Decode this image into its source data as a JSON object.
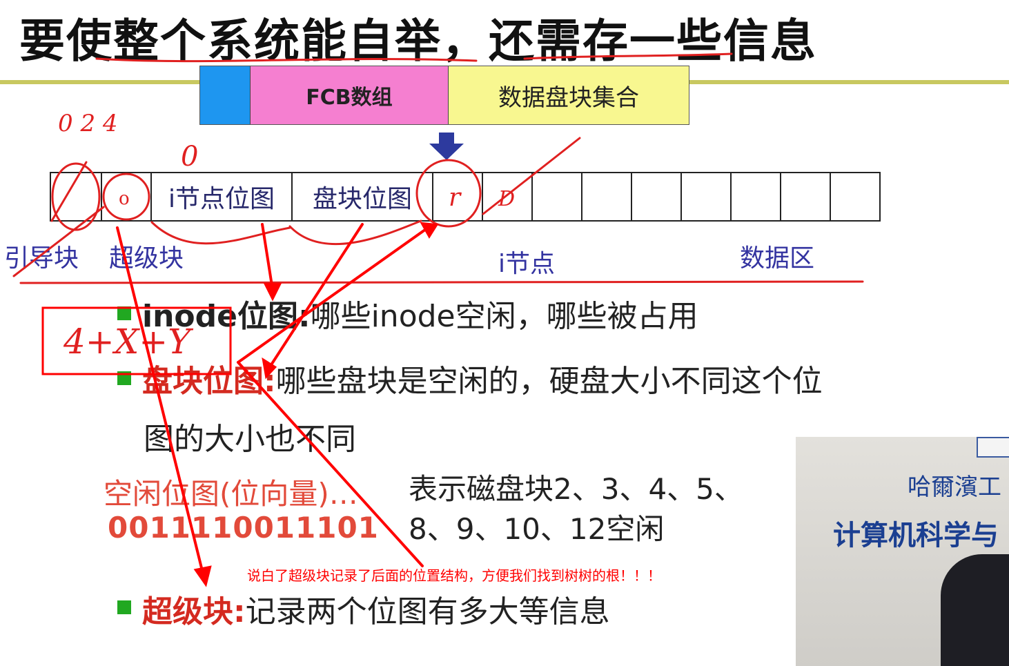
{
  "title": "要使整个系统能自举，还需存一些信息",
  "fcb_bar": {
    "fcb_label": "FCB数组",
    "data_label": "数据盘块集合"
  },
  "disk_layout": {
    "cells": [
      "",
      "",
      "i节点位图",
      "盘块位图",
      "",
      "",
      "",
      "",
      "",
      "",
      "",
      "",
      ""
    ],
    "labels": {
      "boot": "引导块",
      "super": "超级块",
      "inode": "i节点",
      "data": "数据区"
    }
  },
  "bullets": [
    {
      "head": "inode位图:",
      "text": "哪些inode空闲，哪些被占用"
    },
    {
      "head": "盘块位图:",
      "text": "哪些盘块是空闲的，硬盘大小不同这个位",
      "text2": "图的大小也不同"
    },
    {
      "head": "超级块:",
      "text": "记录两个位图有多大等信息"
    }
  ],
  "free_bitmap": {
    "title": "空闲位图(位向量)…",
    "bits": "0011110011101",
    "desc_line1": "表示磁盘块2、3、4、5、",
    "desc_line2": "8、9、10、12空闲"
  },
  "note": "说白了超级块记录了后面的位置结构，方便我们找到树树的根！！！",
  "video": {
    "school": "哈爾濱工",
    "dept": "计算机科学与"
  },
  "handwriting": {
    "nums_top": "0 2 4",
    "zero": "0",
    "o": "o",
    "r": "r",
    "d": "D",
    "formula": "4+X+Y"
  },
  "colors": {
    "accent_red": "#ff0000",
    "ink_red": "#e02020",
    "blue_block": "#1e96f0",
    "pink_block": "#f57fd0",
    "yellow_block": "#f8f790",
    "bullet_green": "#21a821"
  }
}
